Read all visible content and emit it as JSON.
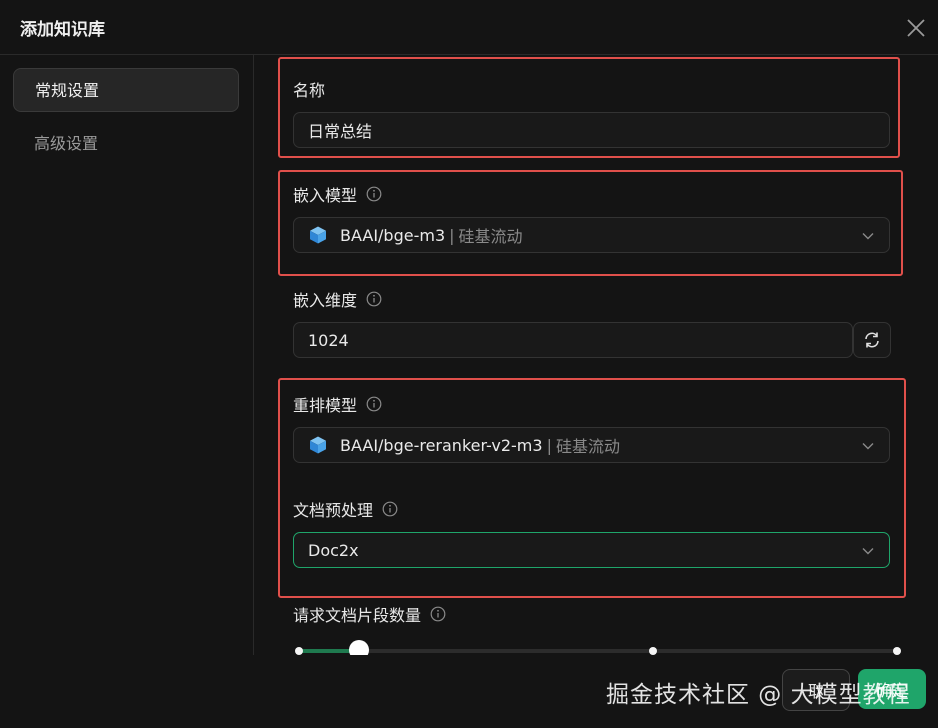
{
  "dialog": {
    "title": "添加知识库"
  },
  "sidebar": {
    "items": [
      {
        "label": "常规设置",
        "active": true
      },
      {
        "label": "高级设置",
        "active": false
      }
    ]
  },
  "form": {
    "name": {
      "label": "名称",
      "value": "日常总结"
    },
    "embedding_model": {
      "label": "嵌入模型",
      "model": "BAAI/bge-m3",
      "separator": "|",
      "provider": "硅基流动"
    },
    "embedding_dim": {
      "label": "嵌入维度",
      "value": "1024"
    },
    "rerank_model": {
      "label": "重排模型",
      "model": "BAAI/bge-reranker-v2-m3",
      "separator": "|",
      "provider": "硅基流动"
    },
    "doc_preprocess": {
      "label": "文档预处理",
      "value": "Doc2x"
    },
    "chunk_count": {
      "label": "请求文档片段数量",
      "value_fraction": 0.1
    }
  },
  "footer": {
    "cancel_label": "取",
    "ok_label": "确定"
  },
  "watermark": "掘金技术社区 @ 大模型教程",
  "colors": {
    "accent": "#1fa56a",
    "highlight_box": "#e0504b",
    "background": "#141414"
  }
}
